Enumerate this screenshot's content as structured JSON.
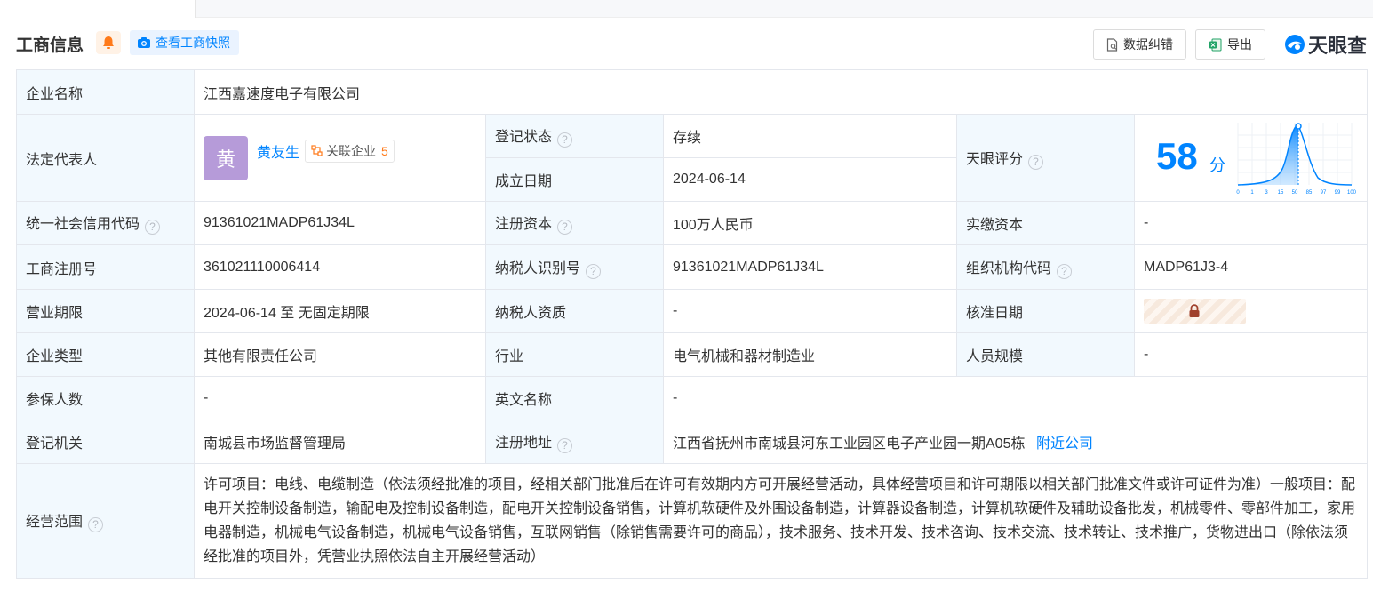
{
  "header": {
    "title": "工商信息",
    "snapshot_label": "查看工商快照",
    "report_error_label": "数据纠错",
    "export_label": "导出",
    "logo_text": "天眼查"
  },
  "colors": {
    "accent": "#0084ff",
    "label_bg": "#f2f9fe",
    "status_green": "#1a9f47",
    "avatar_bg": "#b69bd9"
  },
  "icons": [
    "bell-icon",
    "camera-icon",
    "document-icon",
    "excel-icon",
    "tianyancha-logo-icon",
    "help-icon",
    "link-icon",
    "lock-icon"
  ],
  "labels": {
    "company_name": "企业名称",
    "legal_rep": "法定代表人",
    "reg_status": "登记状态",
    "established": "成立日期",
    "score": "天眼评分",
    "credit_code": "统一社会信用代码",
    "reg_capital": "注册资本",
    "paid_capital": "实缴资本",
    "reg_no": "工商注册号",
    "taxpayer_id": "纳税人识别号",
    "org_code": "组织机构代码",
    "biz_term": "营业期限",
    "taxpayer_qual": "纳税人资质",
    "approval_date": "核准日期",
    "company_type": "企业类型",
    "industry": "行业",
    "staff_size": "人员规模",
    "insured": "参保人数",
    "english_name": "英文名称",
    "reg_authority": "登记机关",
    "reg_address": "注册地址",
    "biz_scope": "经营范围"
  },
  "values": {
    "company_name": "江西嘉速度电子有限公司",
    "legal_rep_avatar": "黄",
    "legal_rep_name": "黄友生",
    "related_label": "关联企业",
    "related_count": "5",
    "reg_status": "存续",
    "established": "2024-06-14",
    "score": "58",
    "score_unit": "分",
    "credit_code": "91361021MADP61J34L",
    "reg_capital": "100万人民币",
    "paid_capital": "-",
    "reg_no": "361021110006414",
    "taxpayer_id": "91361021MADP61J34L",
    "org_code": "MADP61J3-4",
    "biz_term": "2024-06-14 至 无固定期限",
    "taxpayer_qual": "-",
    "company_type": "其他有限责任公司",
    "industry": "电气机械和器材制造业",
    "staff_size": "-",
    "insured": "-",
    "english_name": "-",
    "reg_authority": "南城县市场监督管理局",
    "reg_address": "江西省抚州市南城县河东工业园区电子产业园一期A05栋",
    "nearby_link": "附近公司",
    "biz_scope": "许可项目：电线、电缆制造（依法须经批准的项目，经相关部门批准后在许可有效期内方可开展经营活动，具体经营项目和许可期限以相关部门批准文件或许可证件为准）一般项目：配电开关控制设备制造，输配电及控制设备制造，配电开关控制设备销售，计算机软硬件及外围设备制造，计算器设备制造，计算机软硬件及辅助设备批发，机械零件、零部件加工，家用电器制造，机械电气设备制造，机械电气设备销售，互联网销售（除销售需要许可的商品），技术服务、技术开发、技术咨询、技术交流、技术转让、技术推广，货物进出口（除依法须经批准的项目外，凭营业执照依法自主开展经营活动）"
  },
  "score_chart": {
    "ticks": [
      "0",
      "1",
      "3",
      "15",
      "50",
      "85",
      "97",
      "99",
      "100"
    ],
    "marker_value": 58
  }
}
